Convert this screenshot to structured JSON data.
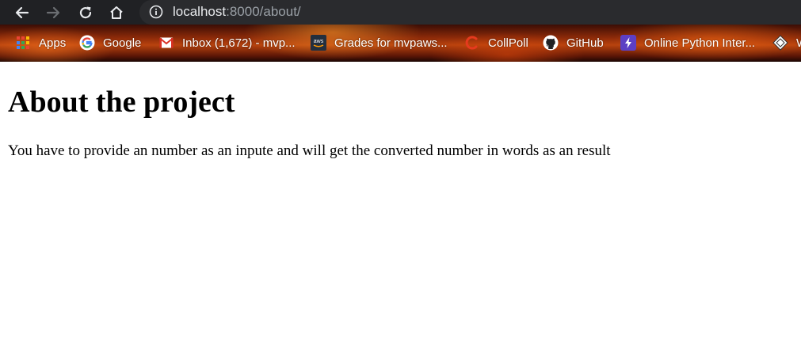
{
  "browser": {
    "address_bar": {
      "host": "localhost",
      "path": ":8000/about/"
    },
    "nav_icons": [
      "back-arrow-icon",
      "forward-arrow-icon",
      "reload-icon",
      "home-icon",
      "info-icon"
    ],
    "bookmarks": [
      {
        "label": "Apps",
        "icon": "apps-grid-icon"
      },
      {
        "label": "Google",
        "icon": "google-icon"
      },
      {
        "label": "Inbox (1,672) - mvp...",
        "icon": "gmail-icon"
      },
      {
        "label": "Grades for mvpaws...",
        "icon": "aws-icon"
      },
      {
        "label": "CollPoll",
        "icon": "collpoll-icon"
      },
      {
        "label": "GitHub",
        "icon": "github-icon"
      },
      {
        "label": "Online Python Inter...",
        "icon": "lightning-icon"
      },
      {
        "label": "W",
        "icon": "site-icon"
      }
    ],
    "colors": {
      "toolbar": "#202124",
      "omnibox": "#2a2b2e",
      "url_host": "#e8eaed",
      "url_path": "#9aa0a6"
    }
  },
  "page": {
    "title": "About the project",
    "text": "You have to provide an number as an inpute and will get the converted number in words as an result"
  }
}
